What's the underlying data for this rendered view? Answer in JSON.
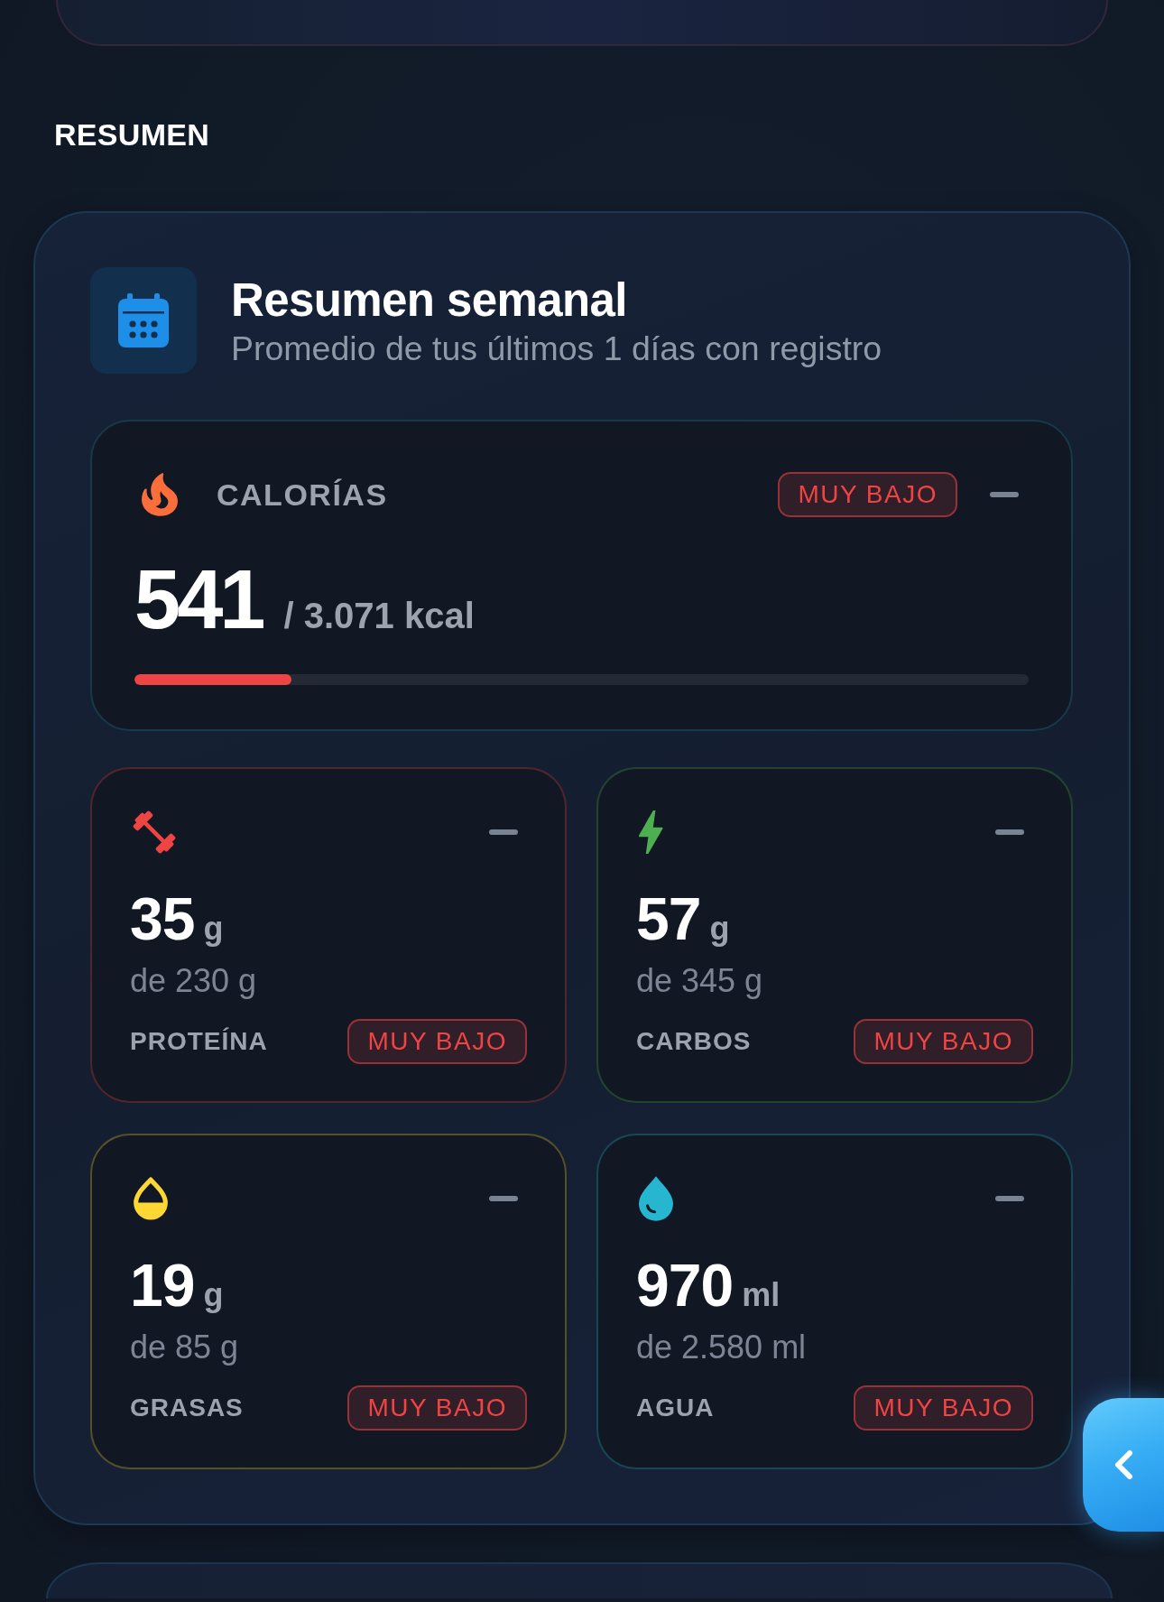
{
  "section_title": "RESUMEN",
  "summary": {
    "title": "Resumen semanal",
    "subtitle": "Promedio de tus últimos 1 días con registro",
    "calories": {
      "label": "CALORÍAS",
      "status": "MUY BAJO",
      "value": "541",
      "target": "/ 3.071 kcal",
      "level": 0.176
    },
    "metrics": [
      {
        "kind": "protein",
        "color": "#ef4444",
        "value": "35",
        "unit": "g",
        "target": "de 230 g",
        "label": "PROTEÍNA",
        "status": "MUY BAJO"
      },
      {
        "kind": "carbs",
        "color": "#4caf50",
        "value": "57",
        "unit": "g",
        "target": "de 345 g",
        "label": "CARBOS",
        "status": "MUY BAJO"
      },
      {
        "kind": "fat",
        "color": "#fdd835",
        "value": "19",
        "unit": "g",
        "target": "de 85 g",
        "label": "GRASAS",
        "status": "MUY BAJO"
      },
      {
        "kind": "water",
        "color": "#26b6cf",
        "value": "970",
        "unit": "ml",
        "target": "de 2.580 ml",
        "label": "AGUA",
        "status": "MUY BAJO"
      }
    ]
  }
}
